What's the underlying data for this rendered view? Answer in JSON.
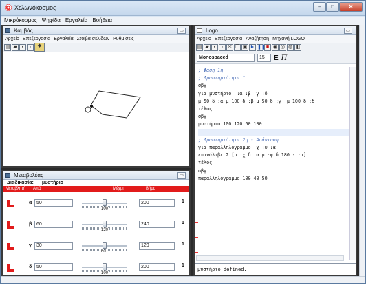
{
  "app": {
    "title": "Χελωνόκοσμος"
  },
  "window_buttons": {
    "minimize": "–",
    "maximize": "□",
    "close": "✕"
  },
  "menubar": [
    "Μικρόκοσμος",
    "Ψηφίδα",
    "Εργαλεία",
    "Βοήθεια"
  ],
  "canvas_frame": {
    "title": "Καμβάς",
    "menu": [
      "Αρχείο",
      "Επεξεργασία",
      "Εργαλεία",
      "Στοίβα σελίδων",
      "Ρυθμίσεις"
    ]
  },
  "vars_frame": {
    "title": "Μεταβολέας",
    "header": {
      "label": "Διαδικασία:",
      "procedure": "μυστήριο"
    },
    "columns": {
      "variable": "Μεταβλητή",
      "from": "Από",
      "to": "Μέχρι",
      "step": "Βήμα"
    },
    "rows": [
      {
        "name": "α",
        "value": "50",
        "slider": "100",
        "max": "200",
        "slider_fraction": 0.5
      },
      {
        "name": "β",
        "value": "60",
        "slider": "120",
        "max": "240",
        "slider_fraction": 0.5
      },
      {
        "name": "γ",
        "value": "30",
        "slider": "60",
        "max": "120",
        "slider_fraction": 0.5
      },
      {
        "name": "δ",
        "value": "50",
        "slider": "100",
        "max": "200",
        "slider_fraction": 0.5
      }
    ],
    "step_visible": "1"
  },
  "logo_frame": {
    "title": "Logo",
    "menu": [
      "Αρχείο",
      "Επεξεργασία",
      "Αναζήτηση",
      "Μηχανή LOGO"
    ],
    "font": "Monospaced",
    "font_size": "15"
  },
  "code_lines": [
    {
      "text": "; Φάση 1η",
      "comment": true
    },
    {
      "text": "; Δραστηριότητα 1",
      "comment": true
    },
    {
      "text": "σβγ",
      "comment": false
    },
    {
      "text": "για μυστήριο  :α :β :γ :δ",
      "comment": false
    },
    {
      "text": "μ 50 δ :α μ 100 δ :β μ 50 δ :γ  μ 100 δ :δ",
      "comment": false
    },
    {
      "text": "τέλος",
      "comment": false
    },
    {
      "text": "σβγ",
      "comment": false
    },
    {
      "text": "μυστήριο 100 120 60 100",
      "comment": false
    },
    {
      "text": "",
      "comment": false,
      "highlight": true
    },
    {
      "text": "; Δραστηριότητα 2η - Απάντηση",
      "comment": true
    },
    {
      "text": "για παραλληλόγραμμο :χ :ψ :α",
      "comment": false
    },
    {
      "text": "επανάλαβε 2 [μ :χ δ :α μ :ψ δ 180 - :α]",
      "comment": false
    },
    {
      "text": "τέλος",
      "comment": false
    },
    {
      "text": "σβγ",
      "comment": false
    },
    {
      "text": "παραλληλόγραμμο 100 40 50",
      "comment": false
    }
  ],
  "output": "μυστήριο defined."
}
